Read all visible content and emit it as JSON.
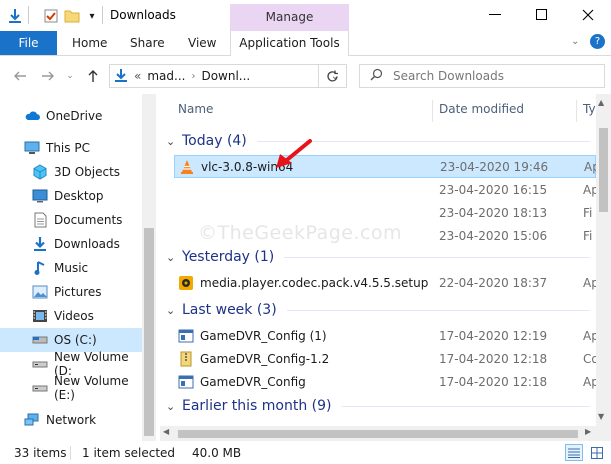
{
  "window": {
    "title": "Downloads",
    "manage_tab": "Manage",
    "watermark": "©TheGeekPage.com"
  },
  "ribbon": {
    "tabs": [
      "File",
      "Home",
      "Share",
      "View"
    ],
    "context_tab": "Application Tools"
  },
  "address": {
    "prefix": "«",
    "crumbs": [
      "mad...",
      "Downl..."
    ],
    "search_placeholder": "Search Downloads"
  },
  "nav": {
    "items": [
      {
        "label": "OneDrive",
        "icon": "cloud-icon",
        "selected": false
      },
      {
        "label": "This PC",
        "icon": "computer-icon",
        "selected": false
      },
      {
        "label": "3D Objects",
        "icon": "cube-icon",
        "selected": false
      },
      {
        "label": "Desktop",
        "icon": "desktop-icon",
        "selected": false
      },
      {
        "label": "Documents",
        "icon": "document-icon",
        "selected": false
      },
      {
        "label": "Downloads",
        "icon": "download-icon",
        "selected": false
      },
      {
        "label": "Music",
        "icon": "music-icon",
        "selected": false
      },
      {
        "label": "Pictures",
        "icon": "pictures-icon",
        "selected": false
      },
      {
        "label": "Videos",
        "icon": "video-icon",
        "selected": false
      },
      {
        "label": "OS (C:)",
        "icon": "drive-icon",
        "selected": true
      },
      {
        "label": "New Volume (D:",
        "icon": "drive-icon",
        "selected": false
      },
      {
        "label": "New Volume (E:)",
        "icon": "drive-icon",
        "selected": false
      },
      {
        "label": "Network",
        "icon": "network-icon",
        "selected": false
      }
    ]
  },
  "columns": {
    "name": "Name",
    "date": "Date modified",
    "type": "Ty"
  },
  "groups": [
    {
      "label": "Today (4)"
    },
    {
      "label": "Yesterday (1)"
    },
    {
      "label": "Last week (3)"
    },
    {
      "label": "Earlier this month (9)"
    }
  ],
  "files": [
    {
      "name": "vlc-3.0.8-win64",
      "date": "23-04-2020 19:46",
      "type": "Ap",
      "icon": "vlc-cone-icon",
      "selected": true
    },
    {
      "name": "",
      "date": "23-04-2020 16:15",
      "type": "Ap",
      "icon": "",
      "selected": false
    },
    {
      "name": "",
      "date": "23-04-2020 18:13",
      "type": "Fi",
      "icon": "",
      "selected": false
    },
    {
      "name": "",
      "date": "23-04-2020 15:06",
      "type": "Fi",
      "icon": "",
      "selected": false
    },
    {
      "name": "media.player.codec.pack.v4.5.5.setup",
      "date": "22-04-2020 18:37",
      "type": "Ap",
      "icon": "installer-icon",
      "selected": false
    },
    {
      "name": "GameDVR_Config (1)",
      "date": "17-04-2020 12:19",
      "type": "Ap",
      "icon": "config-icon",
      "selected": false
    },
    {
      "name": "GameDVR_Config-1.2",
      "date": "17-04-2020 12:18",
      "type": "Co",
      "icon": "zip-icon",
      "selected": false
    },
    {
      "name": "GameDVR_Config",
      "date": "17-04-2020 12:18",
      "type": "Ap",
      "icon": "config-icon",
      "selected": false
    }
  ],
  "status": {
    "count": "33 items",
    "selection": "1 item selected",
    "size": "40.0 MB"
  },
  "colors": {
    "accent": "#1a73c8",
    "selection": "#cce8ff",
    "manage": "#ead5f3",
    "group_header": "#1e3287",
    "arrow": "#e8131a"
  }
}
